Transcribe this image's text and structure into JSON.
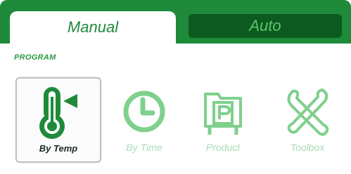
{
  "tabs": [
    {
      "label": "Manual",
      "active": true
    },
    {
      "label": "Auto",
      "active": false
    }
  ],
  "section": {
    "title": "PROGRAM"
  },
  "programs": [
    {
      "label": "By Temp",
      "icon": "thermometer-icon",
      "selected": true
    },
    {
      "label": "By Time",
      "icon": "clock-icon",
      "selected": false
    },
    {
      "label": "Product",
      "icon": "product-folder-icon",
      "selected": false
    },
    {
      "label": "Toolbox",
      "icon": "toolbox-icon",
      "selected": false
    }
  ],
  "colors": {
    "accent": "#1f8a3a",
    "accent_dark": "#0c5a1f",
    "icon_light": "#7fd08d",
    "icon_dark": "#1f8a3a"
  }
}
